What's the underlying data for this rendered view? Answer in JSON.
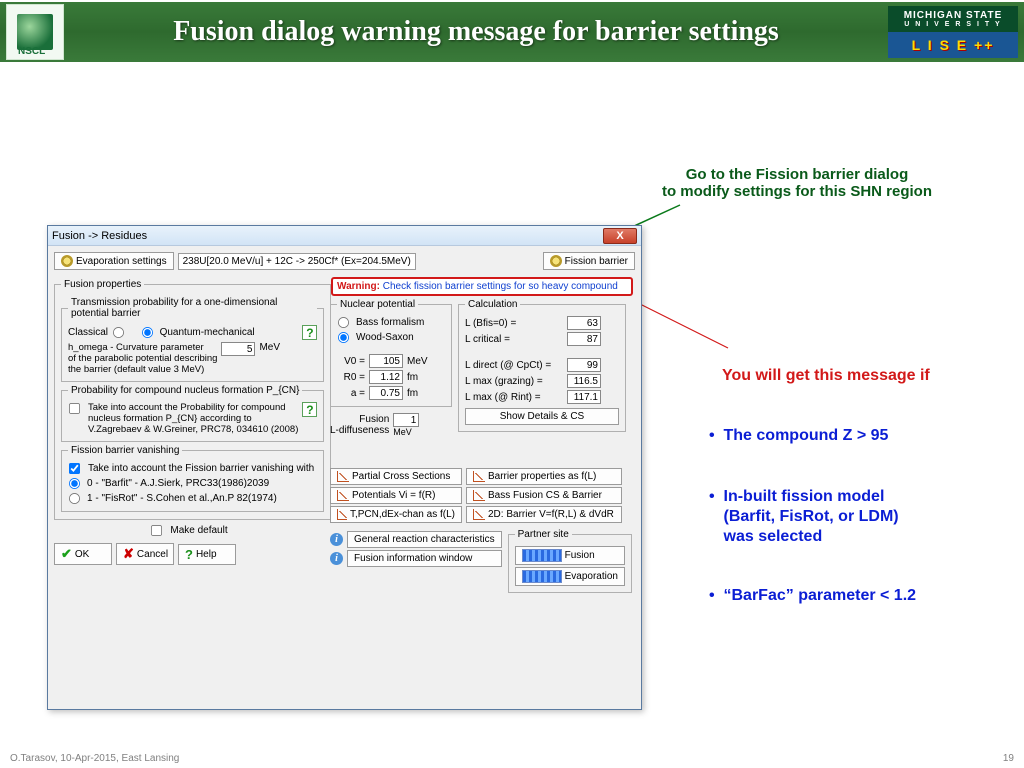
{
  "slide": {
    "title": "Fusion dialog warning message for barrier settings",
    "logo_left_text": "NSCL",
    "msu_text": "MICHIGAN STATE",
    "msu_sub": "U N I V E R S I T Y",
    "lise_text": "L I S E ++"
  },
  "annotations": {
    "go_to_line1": "Go to the Fission barrier dialog",
    "go_to_line2": "to modify settings for this SHN region",
    "msg_heading": "You will get this message if",
    "b1": "The compound  Z > 95",
    "b2a": "In-built fission model",
    "b2b": "(Barfit, FisRot, or LDM)",
    "b2c": "was selected",
    "b3": "“BarFac” parameter < 1.2"
  },
  "dialog": {
    "caption": "Fusion -> Residues",
    "evap_btn": "Evaporation settings",
    "reaction_chip": "238U[20.0 MeV/u] + 12C -> 250Cf* (Ex=204.5MeV)",
    "fission_btn": "Fission barrier",
    "warning_label": "Warning:",
    "warning_text": "Check fission barrier settings for so heavy compound",
    "fusion_props_legend": "Fusion properties",
    "trans_prob_legend": "Transmission probability for a one-dimensional potential barrier",
    "classical": "Classical",
    "quantum": "Quantum-mechanical",
    "homega_l1": "h_omega - Curvature parameter",
    "homega_l2": "of the parabolic potential describing",
    "homega_l3": "the barrier (default value 3 MeV)",
    "homega_val": "5",
    "mev": "MeV",
    "pcn_legend": "Probability for compound nucleus formation P_{CN}",
    "pcn_l1": "Take into account the Probability for compound",
    "pcn_l2": "nucleus formation P_{CN} according to",
    "pcn_l3": "V.Zagrebaev & W.Greiner, PRC78, 034610 (2008)",
    "fbv_legend": "Fission barrier vanishing",
    "fbv_chk": "Take into account the Fission barrier vanishing with",
    "fbv_opt0": "0 - \"Barfit\" - A.J.Sierk, PRC33(1986)2039",
    "fbv_opt1": "1 - \"FisRot\" - S.Cohen et al.,An.P 82(1974)",
    "make_default": "Make default",
    "ok": "OK",
    "cancel": "Cancel",
    "help": "Help",
    "nucpot_legend": "Nuclear potential",
    "bass": "Bass formalism",
    "ws": "Wood-Saxon",
    "V0": "V0 =",
    "V0v": "105",
    "R0": "R0 =",
    "R0v": "1.12",
    "a": "a =",
    "av": "0.75",
    "fm": "fm",
    "fusion_Ldiff_l1": "Fusion",
    "fusion_Ldiff_l2": "L-diffuseness",
    "Ldiff_v": "1",
    "calc_legend": "Calculation",
    "LBfis": "L (Bfis=0) =",
    "LBfis_v": "63",
    "Lcrit": "L critical =",
    "Lcrit_v": "87",
    "Ldir": "L direct (@ CpCt) =",
    "Ldir_v": "99",
    "Lgraz": "L max (grazing) =",
    "Lgraz_v": "116.5",
    "LRint": "L max (@ Rint) =",
    "LRint_v": "117.1",
    "show_details": "Show Details & CS",
    "partial_cs": "Partial Cross Sections",
    "potentials": "Potentials  Vi = f(R)",
    "tpcn": "T,PCN,dEx-chan as f(L)",
    "barprop": "Barrier properties as f(L)",
    "bassfus": "Bass Fusion CS & Barrier",
    "twod": "2D: Barrier V=f(R,L) & dVdR",
    "grc": "General reaction characteristics",
    "fiw": "Fusion information window",
    "partner_legend": "Partner site",
    "partner_fusion": "Fusion",
    "partner_evap": "Evaporation"
  },
  "footer": {
    "left": "O.Tarasov, 10-Apr-2015,   East Lansing",
    "page": "19"
  }
}
